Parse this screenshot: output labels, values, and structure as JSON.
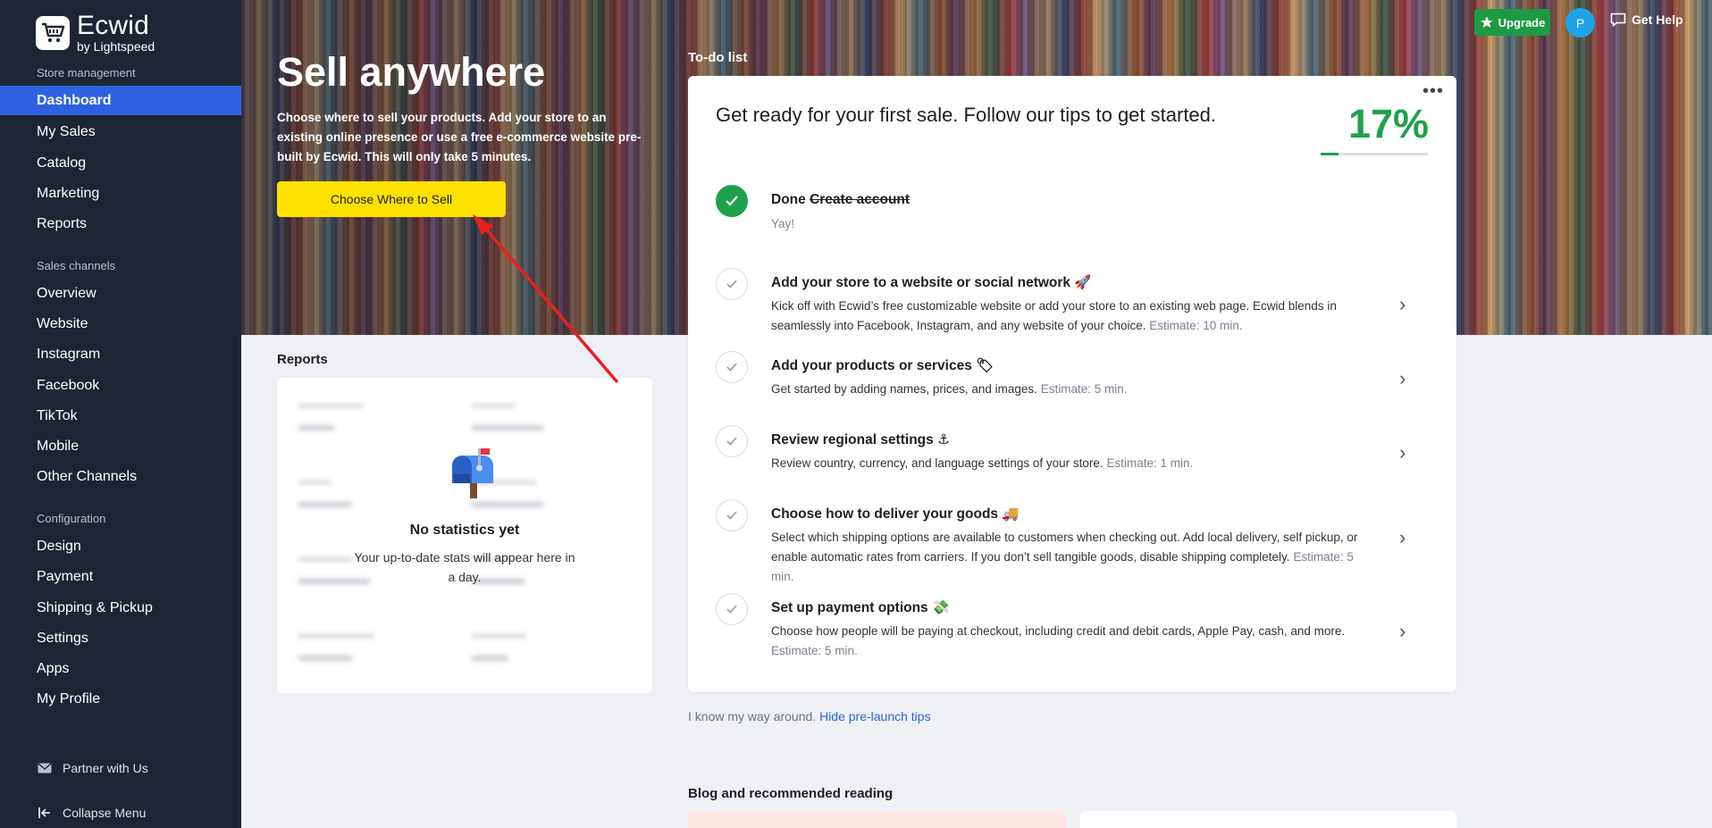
{
  "brand": {
    "name": "Ecwid",
    "sub": "by Lightspeed"
  },
  "sidebar": {
    "store_management_title": "Store management",
    "store_items": [
      {
        "label": "Dashboard"
      },
      {
        "label": "My Sales"
      },
      {
        "label": "Catalog"
      },
      {
        "label": "Marketing"
      },
      {
        "label": "Reports"
      }
    ],
    "sales_channels_title": "Sales channels",
    "channel_items": [
      {
        "label": "Overview"
      },
      {
        "label": "Website"
      },
      {
        "label": "Instagram"
      },
      {
        "label": "Facebook"
      },
      {
        "label": "TikTok"
      },
      {
        "label": "Mobile"
      },
      {
        "label": "Other Channels"
      }
    ],
    "configuration_title": "Configuration",
    "config_items": [
      {
        "label": "Design"
      },
      {
        "label": "Payment"
      },
      {
        "label": "Shipping & Pickup"
      },
      {
        "label": "Settings"
      },
      {
        "label": "Apps"
      },
      {
        "label": "My Profile"
      }
    ],
    "partner_label": "Partner with Us",
    "collapse_label": "Collapse Menu"
  },
  "topbar": {
    "upgrade_label": "Upgrade",
    "avatar_initial": "P",
    "help_label": "Get Help"
  },
  "hero": {
    "title": "Sell anywhere",
    "description": "Choose where to sell your products. Add your store to an existing online presence or use a free e-commerce website pre-built by Ecwid. This will only take 5 minutes.",
    "button_label": "Choose Where to Sell"
  },
  "reports": {
    "title": "Reports",
    "empty_title": "No statistics yet",
    "empty_subtitle": "Your up-to-date stats will appear here in a day."
  },
  "todo": {
    "label": "To-do list",
    "heading": "Get ready for your first sale. Follow our tips to get started.",
    "percent": "17%",
    "progress": 0.17,
    "tasks": [
      {
        "prefix": "Done",
        "title": "Create account",
        "desc": "Yay!",
        "estimate": "",
        "done": true
      },
      {
        "prefix": "",
        "title": "Add your store to a website or social network 🚀",
        "desc": "Kick off with Ecwid’s free customizable website or add your store to an existing web page. Ecwid blends in seamlessly into Facebook, Instagram, and any website of your choice.",
        "estimate": "Estimate: 10 min.",
        "done": false
      },
      {
        "prefix": "",
        "title": "Add your products or services 🏷",
        "desc": "Get started by adding names, prices, and images.",
        "estimate": "Estimate: 5 min.",
        "done": false
      },
      {
        "prefix": "",
        "title": "Review regional settings ⚓",
        "desc": "Review country, currency, and language settings of your store.",
        "estimate": "Estimate: 1 min.",
        "done": false
      },
      {
        "prefix": "",
        "title": "Choose how to deliver your goods 🚚",
        "desc": "Select which shipping options are available to customers when checking out. Add local delivery, self pickup, or enable automatic rates from carriers. If you don’t sell tangible goods, disable shipping completely.",
        "estimate": "Estimate: 5 min.",
        "done": false
      },
      {
        "prefix": "",
        "title": "Set up payment options 💸",
        "desc": "Choose how people will be paying at checkout, including credit and debit cards, Apple Pay, cash, and more.",
        "estimate": "Estimate: 5 min.",
        "done": false
      }
    ]
  },
  "footer_tips": {
    "text": "I know my way around.",
    "link": "Hide pre-launch tips"
  },
  "blog": {
    "title": "Blog and recommended reading"
  },
  "colors": {
    "sidebar": "#1e2532",
    "active": "#2f62e0",
    "accent_yellow": "#ffe100",
    "success": "#1fa14b",
    "annotation": "#e8201a"
  },
  "icons": [
    "logo-cart-icon",
    "star-icon",
    "chat-icon",
    "envelope-icon",
    "collapse-arrow-icon",
    "mailbox-icon",
    "check-icon",
    "chevron-right-icon",
    "more-dots-icon"
  ]
}
